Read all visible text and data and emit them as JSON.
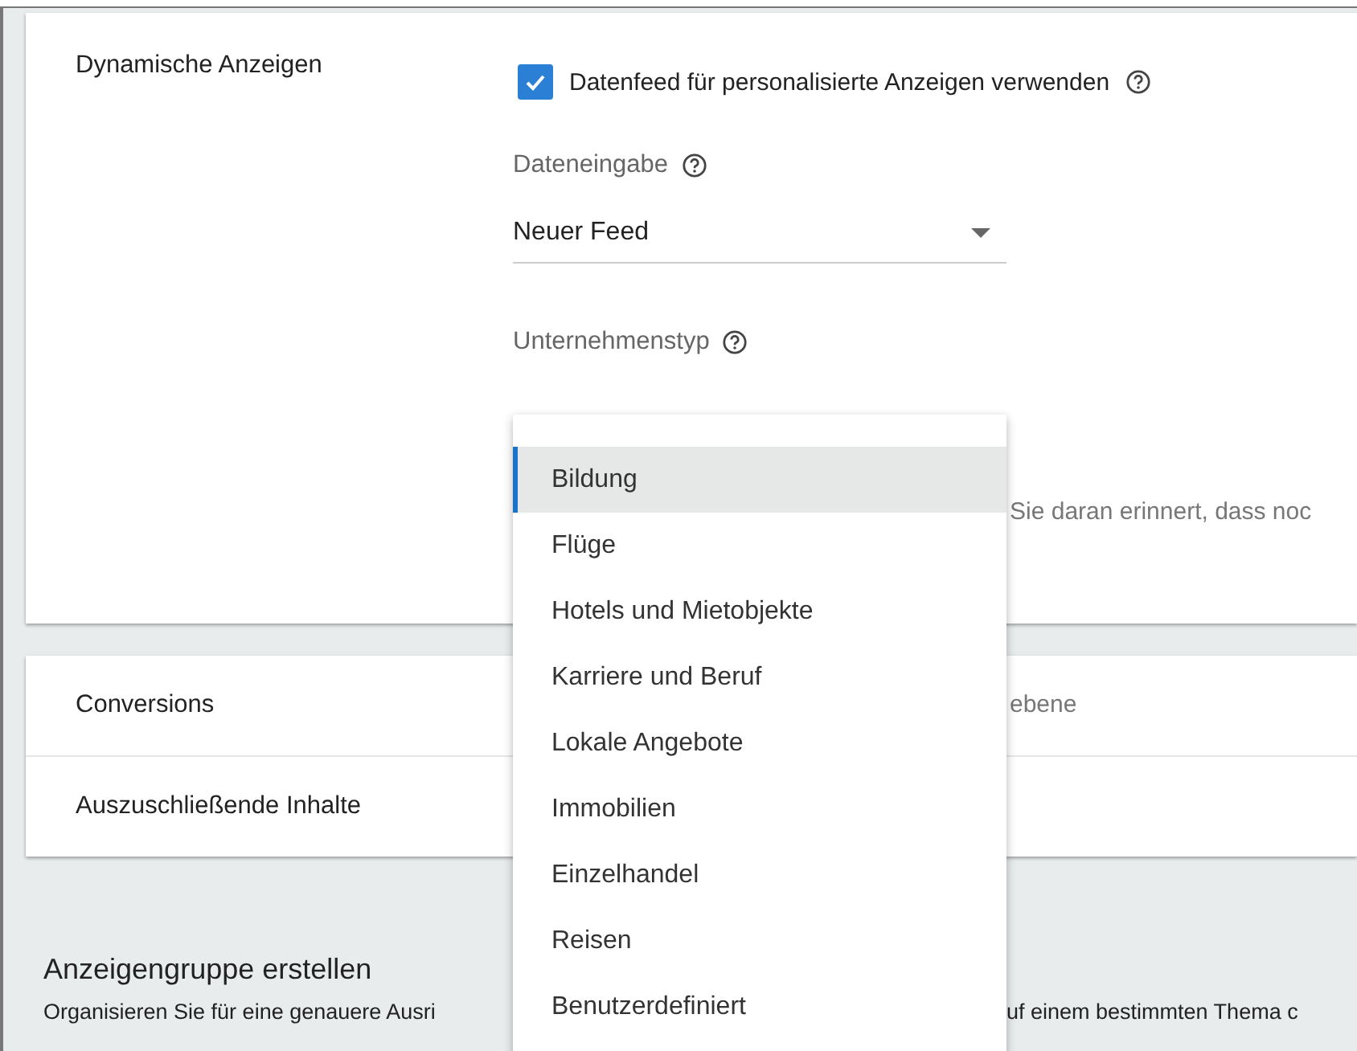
{
  "section": {
    "label": "Dynamische Anzeigen",
    "checkbox": {
      "label": "Datenfeed für personalisierte Anzeigen verwenden",
      "checked": true
    },
    "data_input": {
      "label": "Dateneingabe",
      "value": "Neuer Feed"
    },
    "business_type": {
      "label": "Unternehmenstyp"
    },
    "partial_text": "Sie daran erinnert, dass noc"
  },
  "rows": [
    {
      "label": "Conversions",
      "partial_value": "ebene"
    },
    {
      "label": "Auszuschließende Inhalte"
    }
  ],
  "ad_group": {
    "title": "Anzeigengruppe erstellen",
    "text_left": "Organisieren Sie für eine genauere Ausri",
    "text_right": "uf einem bestimmten Thema c"
  },
  "dropdown_menu": {
    "items": [
      {
        "label": "Bildung",
        "selected": true
      },
      {
        "label": "Flüge",
        "selected": false
      },
      {
        "label": "Hotels und Mietobjekte",
        "selected": false
      },
      {
        "label": "Karriere und Beruf",
        "selected": false
      },
      {
        "label": "Lokale Angebote",
        "selected": false
      },
      {
        "label": "Immobilien",
        "selected": false
      },
      {
        "label": "Einzelhandel",
        "selected": false
      },
      {
        "label": "Reisen",
        "selected": false
      },
      {
        "label": "Benutzerdefiniert",
        "selected": false
      }
    ]
  }
}
